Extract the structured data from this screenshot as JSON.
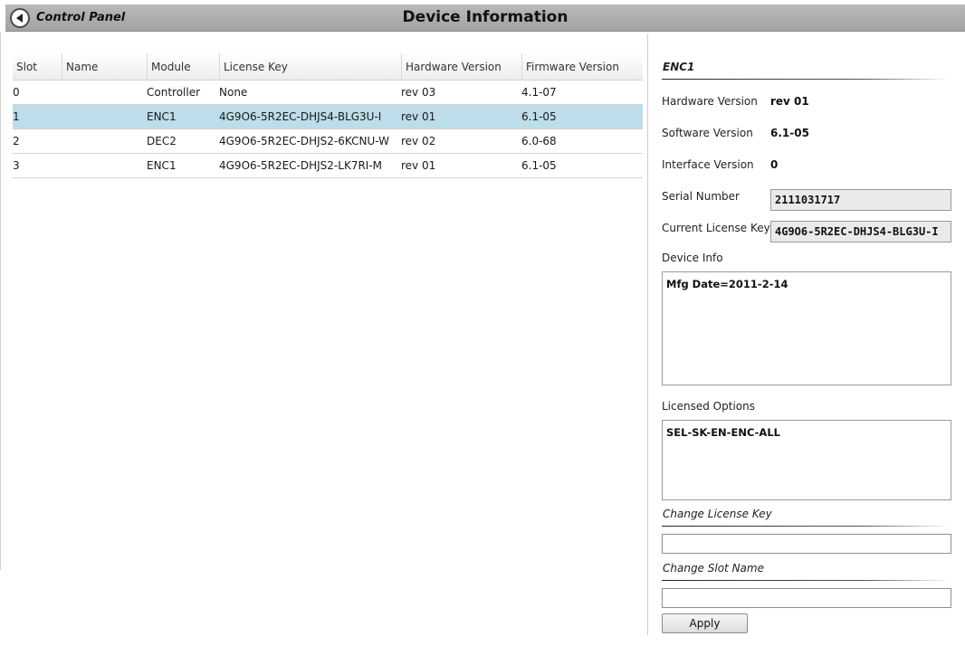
{
  "header": {
    "back_label": "Control Panel",
    "title": "Device Information",
    "back_icon": "back-arrow-icon"
  },
  "table": {
    "columns": [
      "Slot",
      "Name",
      "Module",
      "License Key",
      "Hardware Version",
      "Firmware Version"
    ],
    "rows": [
      {
        "slot": "0",
        "name": "",
        "module": "Controller",
        "license_key": "None",
        "hardware_version": "rev 03",
        "firmware_version": "4.1-07",
        "selected": false
      },
      {
        "slot": "1",
        "name": "",
        "module": "ENC1",
        "license_key": "4G9O6-5R2EC-DHJS4-BLG3U-I",
        "hardware_version": "rev 01",
        "firmware_version": "6.1-05",
        "selected": true
      },
      {
        "slot": "2",
        "name": "",
        "module": "DEC2",
        "license_key": "4G9O6-5R2EC-DHJS2-6KCNU-W",
        "hardware_version": "rev 02",
        "firmware_version": "6.0-68",
        "selected": false
      },
      {
        "slot": "3",
        "name": "",
        "module": "ENC1",
        "license_key": "4G9O6-5R2EC-DHJS2-LK7RI-M",
        "hardware_version": "rev 01",
        "firmware_version": "6.1-05",
        "selected": false
      }
    ]
  },
  "details": {
    "title": "ENC1",
    "hardware_version_label": "Hardware Version",
    "hardware_version_value": "rev 01",
    "software_version_label": "Software Version",
    "software_version_value": "6.1-05",
    "interface_version_label": "Interface Version",
    "interface_version_value": "0",
    "serial_number_label": "Serial Number",
    "serial_number_value": "2111031717",
    "current_license_key_label": "Current License Key",
    "current_license_key_value": "4G9O6-5R2EC-DHJS4-BLG3U-I",
    "device_info_label": "Device Info",
    "device_info_value": "Mfg Date=2011-2-14",
    "licensed_options_label": "Licensed Options",
    "licensed_options_value": "SEL-SK-EN-ENC-ALL",
    "change_license_key_title": "Change License Key",
    "change_license_key_value": "",
    "change_slot_name_title": "Change Slot Name",
    "change_slot_name_value": "",
    "apply_label": "Apply"
  },
  "colors": {
    "header_bg": "#a9a9a9",
    "selected_row": "#bcdde9"
  }
}
